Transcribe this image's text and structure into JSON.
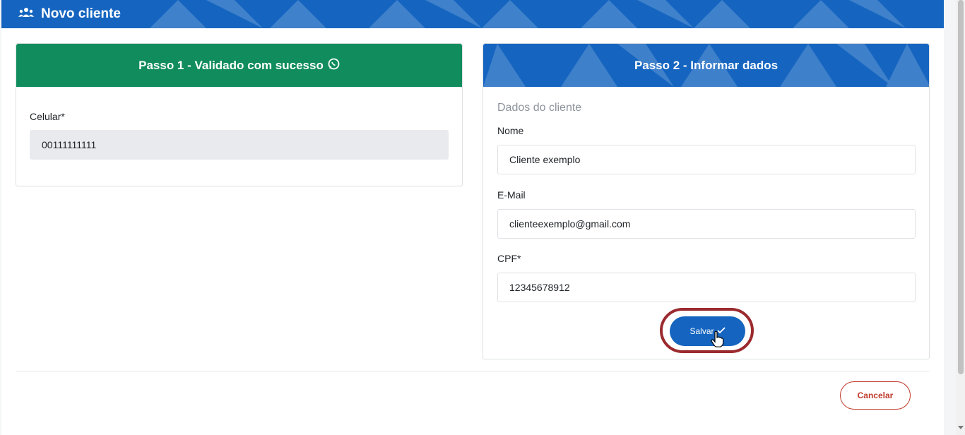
{
  "modal": {
    "title": "Novo cliente",
    "title_icon": "users-icon"
  },
  "step1": {
    "header": "Passo 1 - Validado com sucesso",
    "header_icon": "whatsapp-icon",
    "phone_label": "Celular*",
    "phone_value": "00111111111"
  },
  "step2": {
    "header": "Passo 2 - Informar dados",
    "section_title": "Dados do cliente",
    "name_label": "Nome",
    "name_value": "Cliente exemplo",
    "email_label": "E-Mail",
    "email_value": "clienteexemplo@gmail.com",
    "cpf_label": "CPF*",
    "cpf_value": "12345678912",
    "save_label": "Salvar",
    "save_icon": "check-icon"
  },
  "footer": {
    "cancel_label": "Cancelar"
  },
  "colors": {
    "primary": "#1565c0",
    "success": "#118d5d",
    "danger": "#c0392b",
    "highlight": "#9b2a2e"
  }
}
